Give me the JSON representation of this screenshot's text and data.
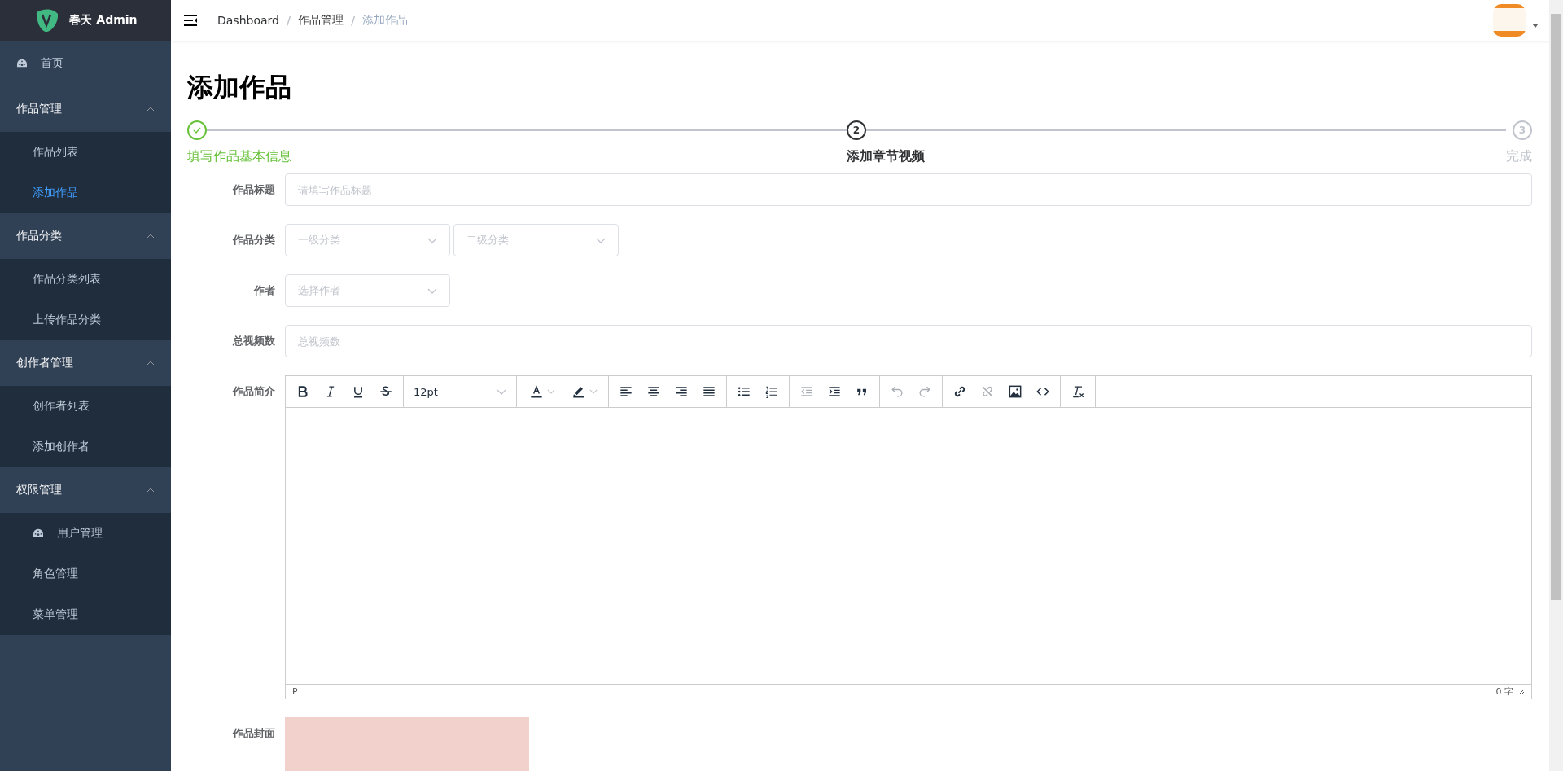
{
  "sidebar": {
    "logo_text": "春天 Admin",
    "items": [
      {
        "label": "首页",
        "kind": "link",
        "selected": false
      },
      {
        "label": "作品管理",
        "kind": "group",
        "expanded": true,
        "children": [
          {
            "label": "作品列表",
            "kind": "link",
            "selected": false
          },
          {
            "label": "添加作品",
            "kind": "link",
            "selected": true
          }
        ]
      },
      {
        "label": "作品分类",
        "kind": "group",
        "expanded": true,
        "children": [
          {
            "label": "作品分类列表",
            "kind": "link",
            "selected": false
          },
          {
            "label": "上传作品分类",
            "kind": "link",
            "selected": false
          }
        ]
      },
      {
        "label": "创作者管理",
        "kind": "group",
        "expanded": true,
        "children": [
          {
            "label": "创作者列表",
            "kind": "link",
            "selected": false
          },
          {
            "label": "添加创作者",
            "kind": "link",
            "selected": false
          }
        ]
      },
      {
        "label": "权限管理",
        "kind": "group",
        "expanded": true,
        "children": [
          {
            "label": "用户管理",
            "kind": "icon-link",
            "selected": false
          },
          {
            "label": "角色管理",
            "kind": "link",
            "selected": false
          },
          {
            "label": "菜单管理",
            "kind": "link",
            "selected": false
          }
        ]
      }
    ]
  },
  "header": {
    "breadcrumb": [
      {
        "label": "Dashboard",
        "current": false
      },
      {
        "separator": "/",
        "label": "作品管理",
        "current": false
      },
      {
        "separator": "/",
        "label": "添加作品",
        "current": true
      }
    ]
  },
  "page_title": "添加作品",
  "steps": [
    {
      "label": "填写作品基本信息",
      "finished": true,
      "active": false
    },
    {
      "label": "添加章节视频",
      "number": "2",
      "finished": false,
      "active": true
    },
    {
      "label": "完成",
      "number": "3",
      "finished": false,
      "active": false
    }
  ],
  "form": [
    {
      "label": "作品标题",
      "kind": "text",
      "placeholder": "请填写作品标题"
    },
    {
      "label": "作品分类",
      "kind": "selects",
      "placeholders": [
        "一级分类",
        "二级分类"
      ]
    },
    {
      "label": "作者",
      "kind": "select",
      "placeholders": [
        "选择作者"
      ]
    },
    {
      "label": "总视频数",
      "kind": "text",
      "placeholder": "总视频数"
    },
    {
      "label": "作品简介",
      "kind": "editor",
      "font_size": "12pt",
      "path": "P",
      "word_count": "0 字",
      "tools": [
        [
          {
            "kind": "bold",
            "disabled": false
          },
          {
            "kind": "italic",
            "disabled": false
          },
          {
            "kind": "underline",
            "disabled": false
          },
          {
            "kind": "strike",
            "disabled": false
          }
        ],
        [
          {
            "kind": "fontsize"
          }
        ],
        [
          {
            "kind": "forecolor",
            "disabled": false
          },
          {
            "kind": "highlight",
            "disabled": false
          }
        ],
        [
          {
            "kind": "align-left",
            "disabled": false
          },
          {
            "kind": "align-center",
            "disabled": false
          },
          {
            "kind": "align-right",
            "disabled": false
          },
          {
            "kind": "justify",
            "disabled": false
          }
        ],
        [
          {
            "kind": "bullist",
            "disabled": false
          },
          {
            "kind": "numlist",
            "disabled": false
          }
        ],
        [
          {
            "kind": "outdent",
            "disabled": true
          },
          {
            "kind": "indent",
            "disabled": false
          },
          {
            "kind": "quote",
            "disabled": false
          }
        ],
        [
          {
            "kind": "undo",
            "disabled": true
          },
          {
            "kind": "redo",
            "disabled": true
          }
        ],
        [
          {
            "kind": "link",
            "disabled": false
          },
          {
            "kind": "unlink",
            "disabled": true
          },
          {
            "kind": "image",
            "disabled": false
          },
          {
            "kind": "code",
            "disabled": false
          }
        ],
        [
          {
            "kind": "clear",
            "disabled": false
          }
        ]
      ]
    },
    {
      "label": "作品封面",
      "kind": "upload"
    }
  ]
}
